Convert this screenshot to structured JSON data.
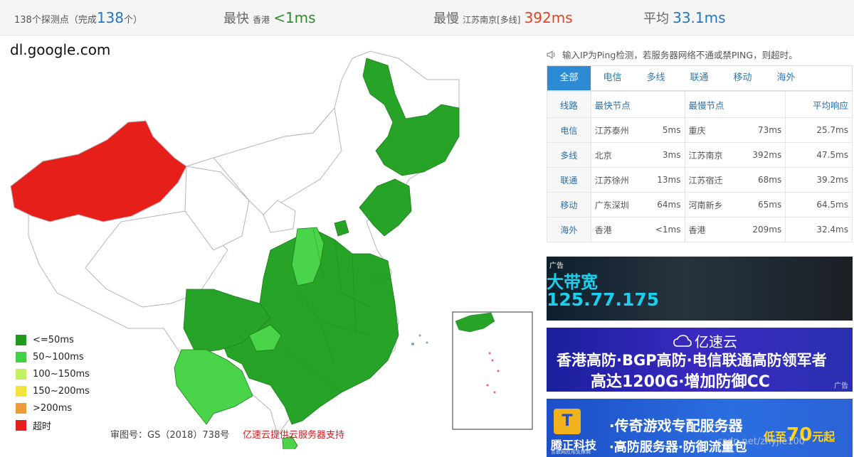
{
  "topbar": {
    "probes": {
      "prefix": "138个探测点（完成",
      "count": "138",
      "suffix": "个）"
    },
    "fastest": {
      "label": "最快",
      "location": "香港",
      "value": "<1ms"
    },
    "slowest": {
      "label": "最慢",
      "location": "江苏南京[多线]",
      "value": "392ms"
    },
    "average": {
      "label": "平均",
      "value": "33.1ms"
    }
  },
  "domain": "dl.google.com",
  "legend": [
    {
      "label": "<=50ms",
      "color": "#1f9a1f"
    },
    {
      "label": "50~100ms",
      "color": "#43d143"
    },
    {
      "label": "100~150ms",
      "color": "#c3f060"
    },
    {
      "label": "150~200ms",
      "color": "#f4e33b"
    },
    {
      "label": ">200ms",
      "color": "#ef9a3a"
    },
    {
      "label": "超时",
      "color": "#e3201b"
    }
  ],
  "map_colors": {
    "fast": "#27a327",
    "medium": "#49d449",
    "timeout": "#e71f1a",
    "none": "#ffffff",
    "border": "#b5b5b5"
  },
  "footer": {
    "approval": "审图号：GS（2018）738号",
    "credit": "亿速云提供云服务器支持"
  },
  "notice": {
    "icon": "speaker-icon",
    "text": "输入IP为Ping检测，若服务器网络不通或禁PING，则超时。"
  },
  "tabs": [
    {
      "label": "全部",
      "active": true
    },
    {
      "label": "电信",
      "active": false
    },
    {
      "label": "多线",
      "active": false
    },
    {
      "label": "联通",
      "active": false
    },
    {
      "label": "移动",
      "active": false
    },
    {
      "label": "海外",
      "active": false
    }
  ],
  "table": {
    "headers": {
      "line": "线路",
      "fastest": "最快节点",
      "slowest": "最慢节点",
      "average": "平均响应"
    },
    "rows": [
      {
        "line": "电信",
        "fast_node": "江苏泰州",
        "fast_ms": "5ms",
        "slow_node": "重庆",
        "slow_ms": "73ms",
        "avg": "25.7ms"
      },
      {
        "line": "多线",
        "fast_node": "北京",
        "fast_ms": "3ms",
        "slow_node": "江苏南京",
        "slow_ms": "392ms",
        "avg": "47.5ms"
      },
      {
        "line": "联通",
        "fast_node": "江苏徐州",
        "fast_ms": "13ms",
        "slow_node": "江苏宿迁",
        "slow_ms": "68ms",
        "avg": "39.2ms"
      },
      {
        "line": "移动",
        "fast_node": "广东深圳",
        "fast_ms": "64ms",
        "slow_node": "河南新乡",
        "slow_ms": "65ms",
        "avg": "64.5ms"
      },
      {
        "line": "海外",
        "fast_node": "香港",
        "fast_ms": "<1ms",
        "slow_node": "香港",
        "slow_ms": "209ms",
        "avg": "32.4ms"
      }
    ]
  },
  "ads": {
    "ad1": {
      "tag": "广告",
      "line1": "大带宽",
      "line2": "125.77.175"
    },
    "ad2": {
      "brand": "亿速云",
      "line1": "香港高防·BGP高防·电信联通高防领军者",
      "line2": "高达1200G·增加防御CC",
      "tag": "广告"
    },
    "ad3": {
      "brand": "腾正科技",
      "brand_sub": "互联网应用支撑商",
      "line1": "·传奇游戏专配服务器",
      "line2": "·高防服务器·防御流量包",
      "price_prefix": "低至",
      "price_value": "70",
      "price_suffix": "元起"
    }
  },
  "watermark": "csdn.net/zhyjie100"
}
